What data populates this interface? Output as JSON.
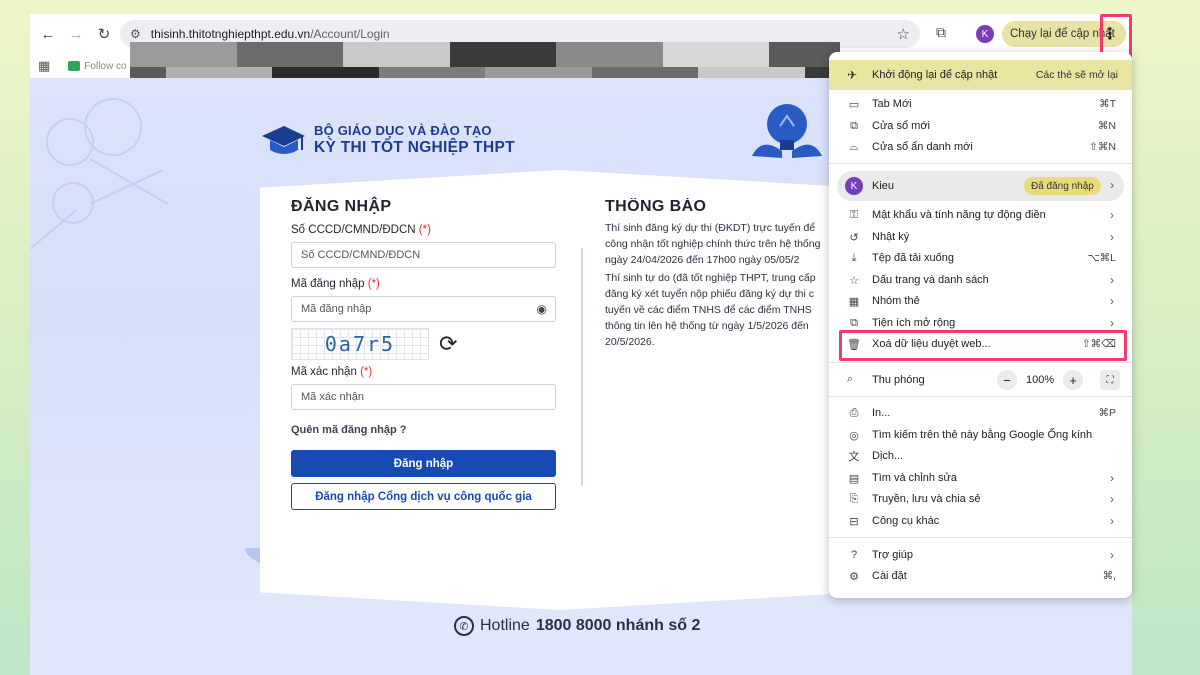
{
  "browser": {
    "url_host": "thisinh.thitotnghiepthpt.edu.vn",
    "url_path": "/Account/Login",
    "profile_initial": "K",
    "update_button_label": "Chạy lại để cập nhật",
    "bookmark_label": "Follow co"
  },
  "site": {
    "ministry": "BỘ GIÁO DỤC VÀ ĐÀO TẠO",
    "exam_name": "KỲ THI TỐT NGHIỆP THPT",
    "hotline_prefix": "Hotline",
    "hotline_number": "1800 8000 nhánh số 2"
  },
  "login": {
    "title": "ĐĂNG NHẬP",
    "id_label": "Số CCCD/CMND/ĐDCN",
    "id_placeholder": "Số CCCD/CMND/ĐDCN",
    "password_label": "Mã đăng nhập",
    "password_placeholder": "Mã đăng nhập",
    "captcha_text": "0a7r5",
    "captcha_label": "Mã xác nhận",
    "captcha_placeholder": "Mã xác nhận",
    "required_mark": "(*)",
    "forgot_label": "Quên mã đăng nhập ?",
    "submit_label": "Đăng nhập",
    "national_portal_label": "Đăng nhập Cổng dịch vụ công quốc gia"
  },
  "notice": {
    "title": "THÔNG BÁO",
    "paragraph1": "Thí sinh đăng ký dự thi (ĐKDT) trực tuyến để\ncông nhận tốt nghiệp chính thức trên hệ thống\nngày 24/04/2026 đến 17h00 ngày 05/05/2",
    "paragraph2": "Thí sinh tự do (đã tốt nghiệp THPT, trung cấp\nđăng ký xét tuyển nộp phiếu đăng ký dự thi c\ntuyến về các điểm TNHS để các điểm TNHS\nthông tin lên hệ thống từ ngày 1/5/2026 đến\n20/5/2026."
  },
  "menu": {
    "update": {
      "label": "Khởi động lại để cập nhật",
      "shortcut": "Các thẻ sẽ mở lại"
    },
    "new_tab": {
      "label": "Tab Mới",
      "shortcut": "⌘T"
    },
    "new_window": {
      "label": "Cửa sổ mới",
      "shortcut": "⌘N"
    },
    "incognito": {
      "label": "Cửa sổ ẩn danh mới",
      "shortcut": "⇧⌘N"
    },
    "profile": {
      "initial": "K",
      "name": "Kieu",
      "status": "Đã đăng nhập"
    },
    "passwords": {
      "label": "Mật khẩu và tính năng tự động điền"
    },
    "history": {
      "label": "Nhật ký"
    },
    "downloads": {
      "label": "Tệp đã tải xuống",
      "shortcut": "⌥⌘L"
    },
    "bookmarks": {
      "label": "Dấu trang và danh sách"
    },
    "tab_groups": {
      "label": "Nhóm thẻ"
    },
    "extensions": {
      "label": "Tiện ích mở rộng"
    },
    "clear_data": {
      "label": "Xoá dữ liệu duyệt web...",
      "shortcut": "⇧⌘⌫"
    },
    "zoom": {
      "label": "Thu phóng",
      "value": "100%",
      "minus": "−",
      "plus": "+"
    },
    "print": {
      "label": "In...",
      "shortcut": "⌘P"
    },
    "lens": {
      "label": "Tìm kiếm trên thẻ này bằng Google Ống kính"
    },
    "translate": {
      "label": "Dịch..."
    },
    "find_edit": {
      "label": "Tìm và chỉnh sửa"
    },
    "cast_save_share": {
      "label": "Truyền, lưu và chia sẻ"
    },
    "more_tools": {
      "label": "Công cụ khác"
    },
    "help": {
      "label": "Trợ giúp"
    },
    "settings": {
      "label": "Cài đặt",
      "shortcut": "⌘,"
    }
  },
  "colors": {
    "primary": "#174bb3",
    "highlight": "#ef3b6d",
    "update_bg": "#eae4a1"
  }
}
